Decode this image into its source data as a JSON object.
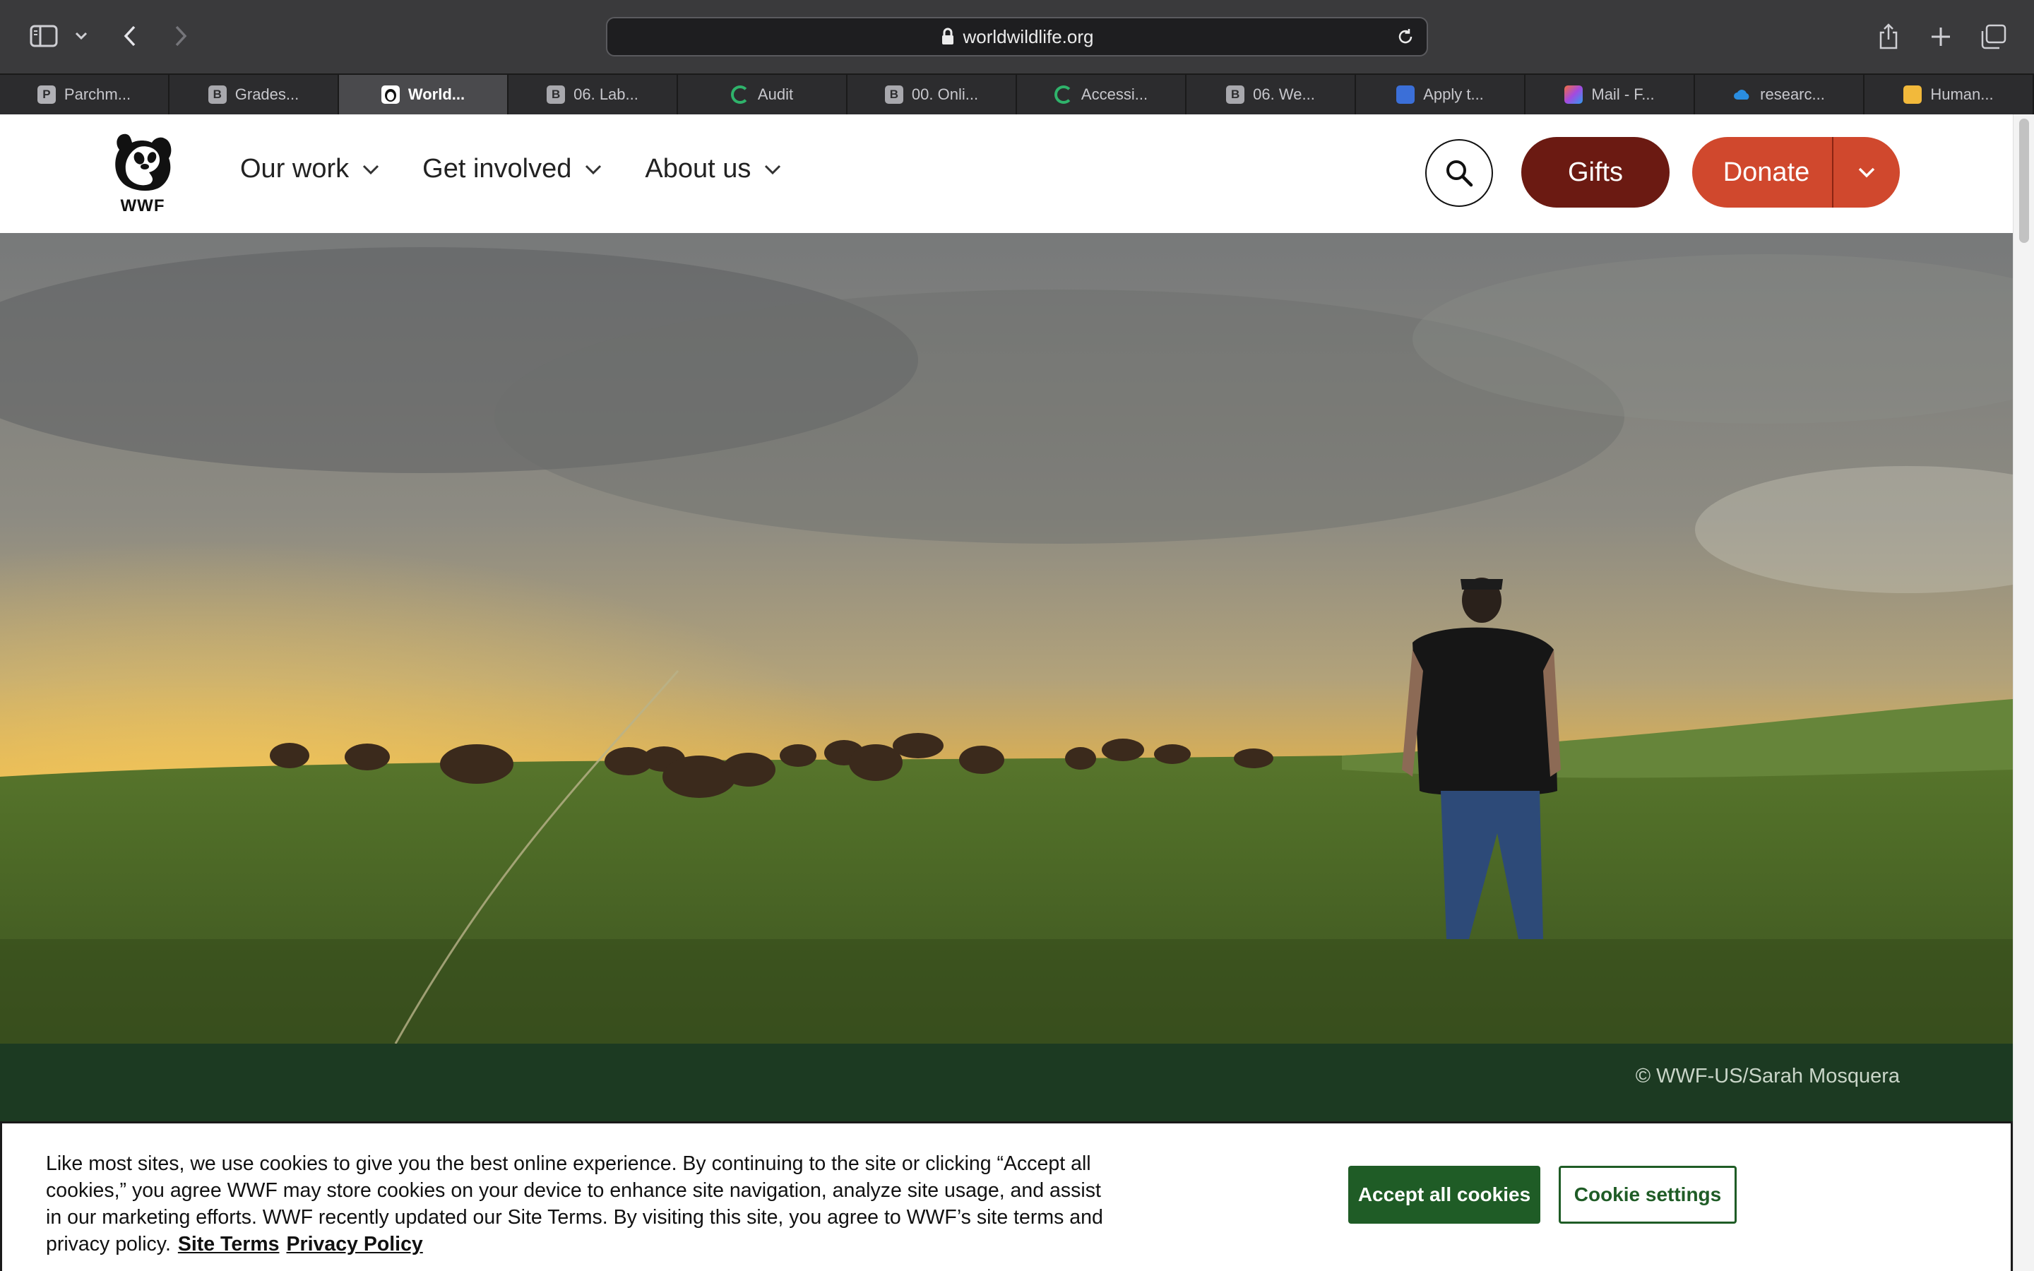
{
  "browser": {
    "url": "worldwildlife.org",
    "tabs": [
      {
        "label": "Parchm...",
        "icon": "P",
        "kind": "p",
        "active": false
      },
      {
        "label": "Grades...",
        "icon": "B",
        "kind": "b",
        "active": false
      },
      {
        "label": "World...",
        "icon": "",
        "kind": "wwf",
        "active": true
      },
      {
        "label": "06. Lab...",
        "icon": "B",
        "kind": "b",
        "active": false
      },
      {
        "label": "Audit",
        "icon": "",
        "kind": "q",
        "active": false
      },
      {
        "label": "00. Onli...",
        "icon": "B",
        "kind": "b",
        "active": false
      },
      {
        "label": "Accessi...",
        "icon": "",
        "kind": "q",
        "active": false
      },
      {
        "label": "06. We...",
        "icon": "B",
        "kind": "b",
        "active": false
      },
      {
        "label": "Apply t...",
        "icon": "",
        "kind": "app",
        "active": false
      },
      {
        "label": "Mail - F...",
        "icon": "",
        "kind": "mail",
        "active": false
      },
      {
        "label": "researc...",
        "icon": "",
        "kind": "cloud",
        "active": false
      },
      {
        "label": "Human...",
        "icon": "",
        "kind": "doc",
        "active": false
      }
    ]
  },
  "site": {
    "logo_text": "WWF",
    "nav": [
      {
        "label": "Our work"
      },
      {
        "label": "Get involved"
      },
      {
        "label": "About us"
      }
    ],
    "gifts_label": "Gifts",
    "donate_label": "Donate",
    "colors": {
      "gifts": "#6b1a12",
      "donate": "#d0482d",
      "credit_bar": "#1c3a22",
      "accept": "#1f5c26"
    }
  },
  "hero": {
    "credit": "© WWF-US/Sarah Mosquera"
  },
  "cookie_banner": {
    "text": "Like most sites, we use cookies to give you the best online experience. By continuing to the site or clicking “Accept all cookies,” you agree WWF may store cookies on your device to enhance site navigation, analyze site usage, and assist in our marketing efforts. WWF recently updated our Site Terms. By visiting this site, you agree to WWF’s site terms and privacy policy.",
    "site_terms_link": "Site Terms",
    "privacy_link": "Privacy Policy",
    "accept_label": "Accept all cookies",
    "settings_label": "Cookie settings"
  }
}
